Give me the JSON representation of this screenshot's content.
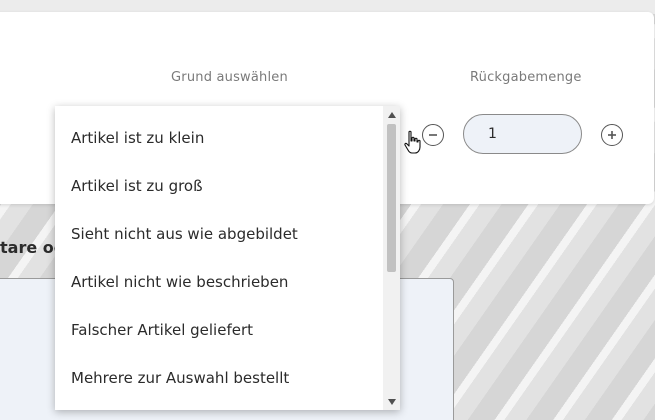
{
  "form": {
    "reason_label": "Grund auswählen",
    "quantity_label": "Rückgabemenge",
    "quantity_value": "1"
  },
  "section": {
    "heading_partial": "tare oc"
  },
  "dropdown": {
    "options": [
      "Artikel ist zu klein",
      "Artikel ist zu groß",
      "Sieht nicht aus wie abgebildet",
      "Artikel nicht wie beschrieben",
      "Falscher Artikel geliefert",
      "Mehrere zur Auswahl bestellt"
    ]
  },
  "icons": {
    "decrease": "minus-circle-icon",
    "increase": "plus-circle-icon",
    "cursor": "hand-pointer-icon",
    "scroll_up": "triangle-up-icon",
    "scroll_down": "triangle-down-icon"
  },
  "colors": {
    "input_background": "#eef2f8",
    "label_gray": "#7a7a7a",
    "text": "#2b2b2b"
  }
}
